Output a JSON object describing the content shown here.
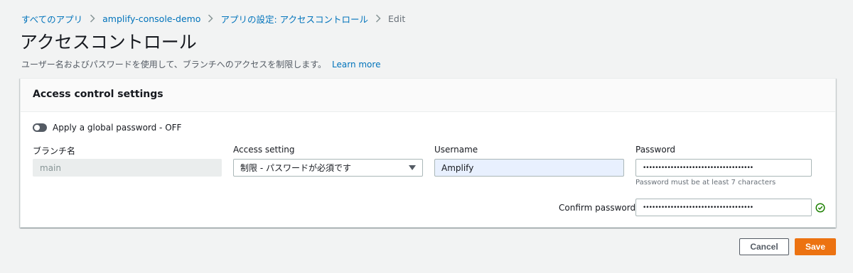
{
  "breadcrumb": {
    "items": [
      "すべてのアプリ",
      "amplify-console-demo",
      "アプリの設定: アクセスコントロール"
    ],
    "current": "Edit"
  },
  "page": {
    "title": "アクセスコントロール",
    "description": "ユーザー名およびパスワードを使用して、ブランチへのアクセスを制限します。",
    "learn_more": "Learn more"
  },
  "panel": {
    "title": "Access control settings",
    "global_password_toggle": {
      "label": "Apply a global password - OFF",
      "state": "off"
    },
    "fields": {
      "branch": {
        "label": "ブランチ名",
        "value": "main"
      },
      "access_setting": {
        "label": "Access setting",
        "value": "制限 - パスワードが必須です"
      },
      "username": {
        "label": "Username",
        "value": "Amplify"
      },
      "password": {
        "label": "Password",
        "value": "••••••••••••••••••••••••••••••••••••",
        "hint": "Password must be at least 7 characters"
      },
      "confirm_password": {
        "label": "Confirm password",
        "value": "••••••••••••••••••••••••••••••••••••"
      }
    }
  },
  "actions": {
    "cancel": "Cancel",
    "save": "Save"
  },
  "colors": {
    "link": "#0073bb",
    "primary": "#ec7211",
    "success": "#1d8102"
  },
  "icons": [
    "chevron-right-icon",
    "caret-down-icon",
    "check-circle-icon"
  ]
}
